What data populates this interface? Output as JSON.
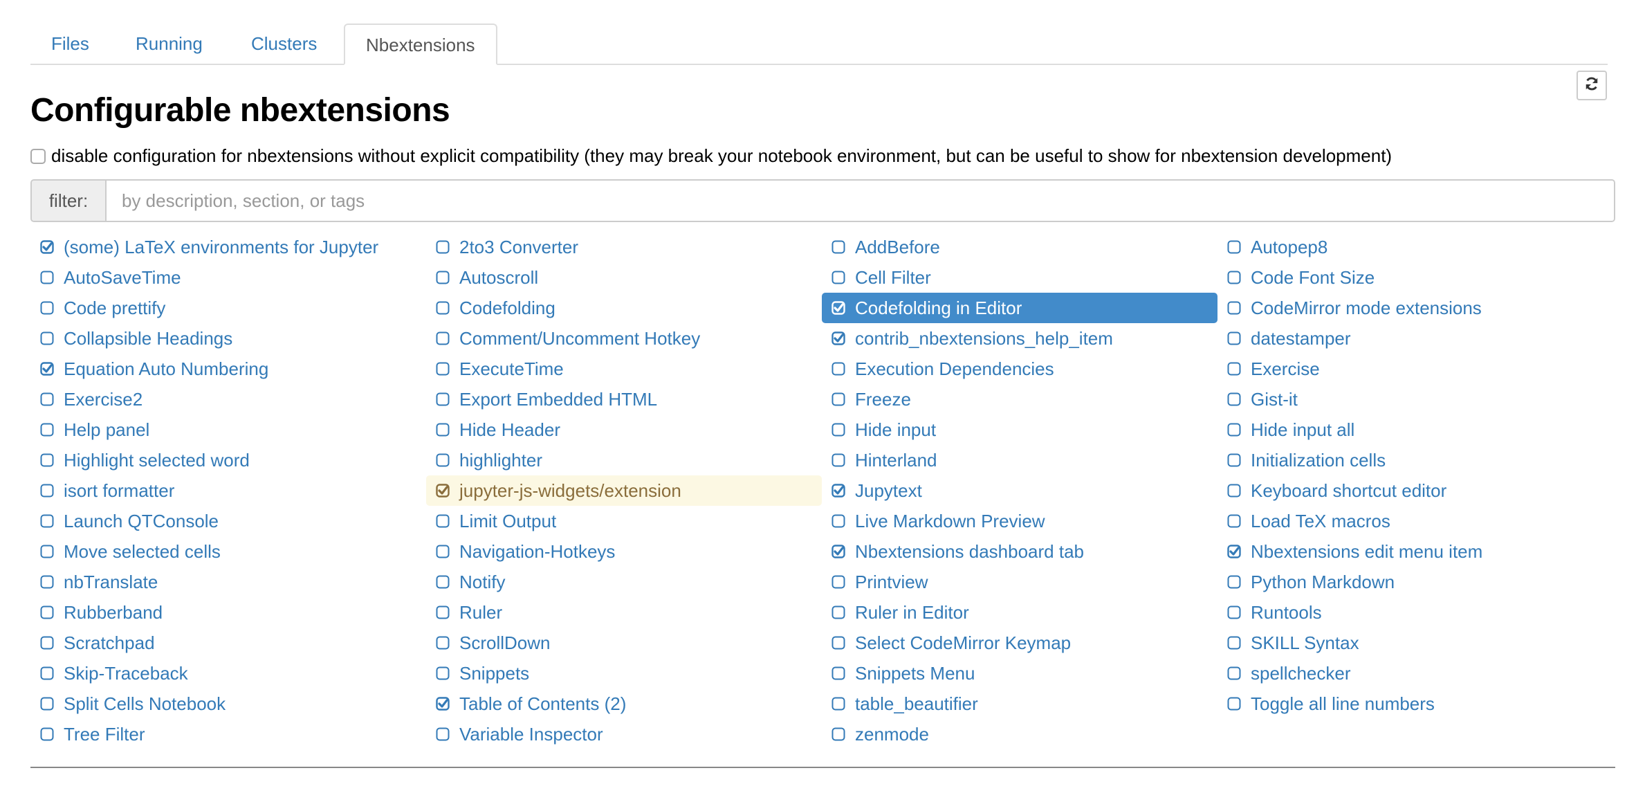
{
  "tabs": [
    {
      "label": "Files",
      "active": false
    },
    {
      "label": "Running",
      "active": false
    },
    {
      "label": "Clusters",
      "active": false
    },
    {
      "label": "Nbextensions",
      "active": true
    }
  ],
  "refresh_icon": "refresh-icon",
  "heading": "Configurable nbextensions",
  "compat": {
    "checked": false,
    "label": "disable configuration for nbextensions without explicit compatibility (they may break your notebook environment, but can be useful to show for nbextension development)"
  },
  "filter": {
    "label": "filter:",
    "value": "",
    "placeholder": "by description, section, or tags"
  },
  "colors": {
    "link": "#337ab7",
    "selected_bg": "#428bca",
    "warning_bg": "#fcf8e3",
    "warning_text": "#8a6d3b"
  },
  "extensions": [
    {
      "label": "(some) LaTeX environments for Jupyter",
      "checked": true
    },
    {
      "label": "2to3 Converter",
      "checked": false
    },
    {
      "label": "AddBefore",
      "checked": false
    },
    {
      "label": "Autopep8",
      "checked": false
    },
    {
      "label": "AutoSaveTime",
      "checked": false
    },
    {
      "label": "Autoscroll",
      "checked": false
    },
    {
      "label": "Cell Filter",
      "checked": false
    },
    {
      "label": "Code Font Size",
      "checked": false
    },
    {
      "label": "Code prettify",
      "checked": false
    },
    {
      "label": "Codefolding",
      "checked": false
    },
    {
      "label": "Codefolding in Editor",
      "checked": true,
      "state": "selected"
    },
    {
      "label": "CodeMirror mode extensions",
      "checked": false
    },
    {
      "label": "Collapsible Headings",
      "checked": false
    },
    {
      "label": "Comment/Uncomment Hotkey",
      "checked": false
    },
    {
      "label": "contrib_nbextensions_help_item",
      "checked": true
    },
    {
      "label": "datestamper",
      "checked": false
    },
    {
      "label": "Equation Auto Numbering",
      "checked": true
    },
    {
      "label": "ExecuteTime",
      "checked": false
    },
    {
      "label": "Execution Dependencies",
      "checked": false
    },
    {
      "label": "Exercise",
      "checked": false
    },
    {
      "label": "Exercise2",
      "checked": false
    },
    {
      "label": "Export Embedded HTML",
      "checked": false
    },
    {
      "label": "Freeze",
      "checked": false
    },
    {
      "label": "Gist-it",
      "checked": false
    },
    {
      "label": "Help panel",
      "checked": false
    },
    {
      "label": "Hide Header",
      "checked": false
    },
    {
      "label": "Hide input",
      "checked": false
    },
    {
      "label": "Hide input all",
      "checked": false
    },
    {
      "label": "Highlight selected word",
      "checked": false
    },
    {
      "label": "highlighter",
      "checked": false
    },
    {
      "label": "Hinterland",
      "checked": false
    },
    {
      "label": "Initialization cells",
      "checked": false
    },
    {
      "label": "isort formatter",
      "checked": false
    },
    {
      "label": "jupyter-js-widgets/extension",
      "checked": true,
      "state": "warning"
    },
    {
      "label": "Jupytext",
      "checked": true
    },
    {
      "label": "Keyboard shortcut editor",
      "checked": false
    },
    {
      "label": "Launch QTConsole",
      "checked": false
    },
    {
      "label": "Limit Output",
      "checked": false
    },
    {
      "label": "Live Markdown Preview",
      "checked": false
    },
    {
      "label": "Load TeX macros",
      "checked": false
    },
    {
      "label": "Move selected cells",
      "checked": false
    },
    {
      "label": "Navigation-Hotkeys",
      "checked": false
    },
    {
      "label": "Nbextensions dashboard tab",
      "checked": true
    },
    {
      "label": "Nbextensions edit menu item",
      "checked": true
    },
    {
      "label": "nbTranslate",
      "checked": false
    },
    {
      "label": "Notify",
      "checked": false
    },
    {
      "label": "Printview",
      "checked": false
    },
    {
      "label": "Python Markdown",
      "checked": false
    },
    {
      "label": "Rubberband",
      "checked": false
    },
    {
      "label": "Ruler",
      "checked": false
    },
    {
      "label": "Ruler in Editor",
      "checked": false
    },
    {
      "label": "Runtools",
      "checked": false
    },
    {
      "label": "Scratchpad",
      "checked": false
    },
    {
      "label": "ScrollDown",
      "checked": false
    },
    {
      "label": "Select CodeMirror Keymap",
      "checked": false
    },
    {
      "label": "SKILL Syntax",
      "checked": false
    },
    {
      "label": "Skip-Traceback",
      "checked": false
    },
    {
      "label": "Snippets",
      "checked": false
    },
    {
      "label": "Snippets Menu",
      "checked": false
    },
    {
      "label": "spellchecker",
      "checked": false
    },
    {
      "label": "Split Cells Notebook",
      "checked": false
    },
    {
      "label": "Table of Contents (2)",
      "checked": true
    },
    {
      "label": "table_beautifier",
      "checked": false
    },
    {
      "label": "Toggle all line numbers",
      "checked": false
    },
    {
      "label": "Tree Filter",
      "checked": false
    },
    {
      "label": "Variable Inspector",
      "checked": false
    },
    {
      "label": "zenmode",
      "checked": false
    }
  ]
}
